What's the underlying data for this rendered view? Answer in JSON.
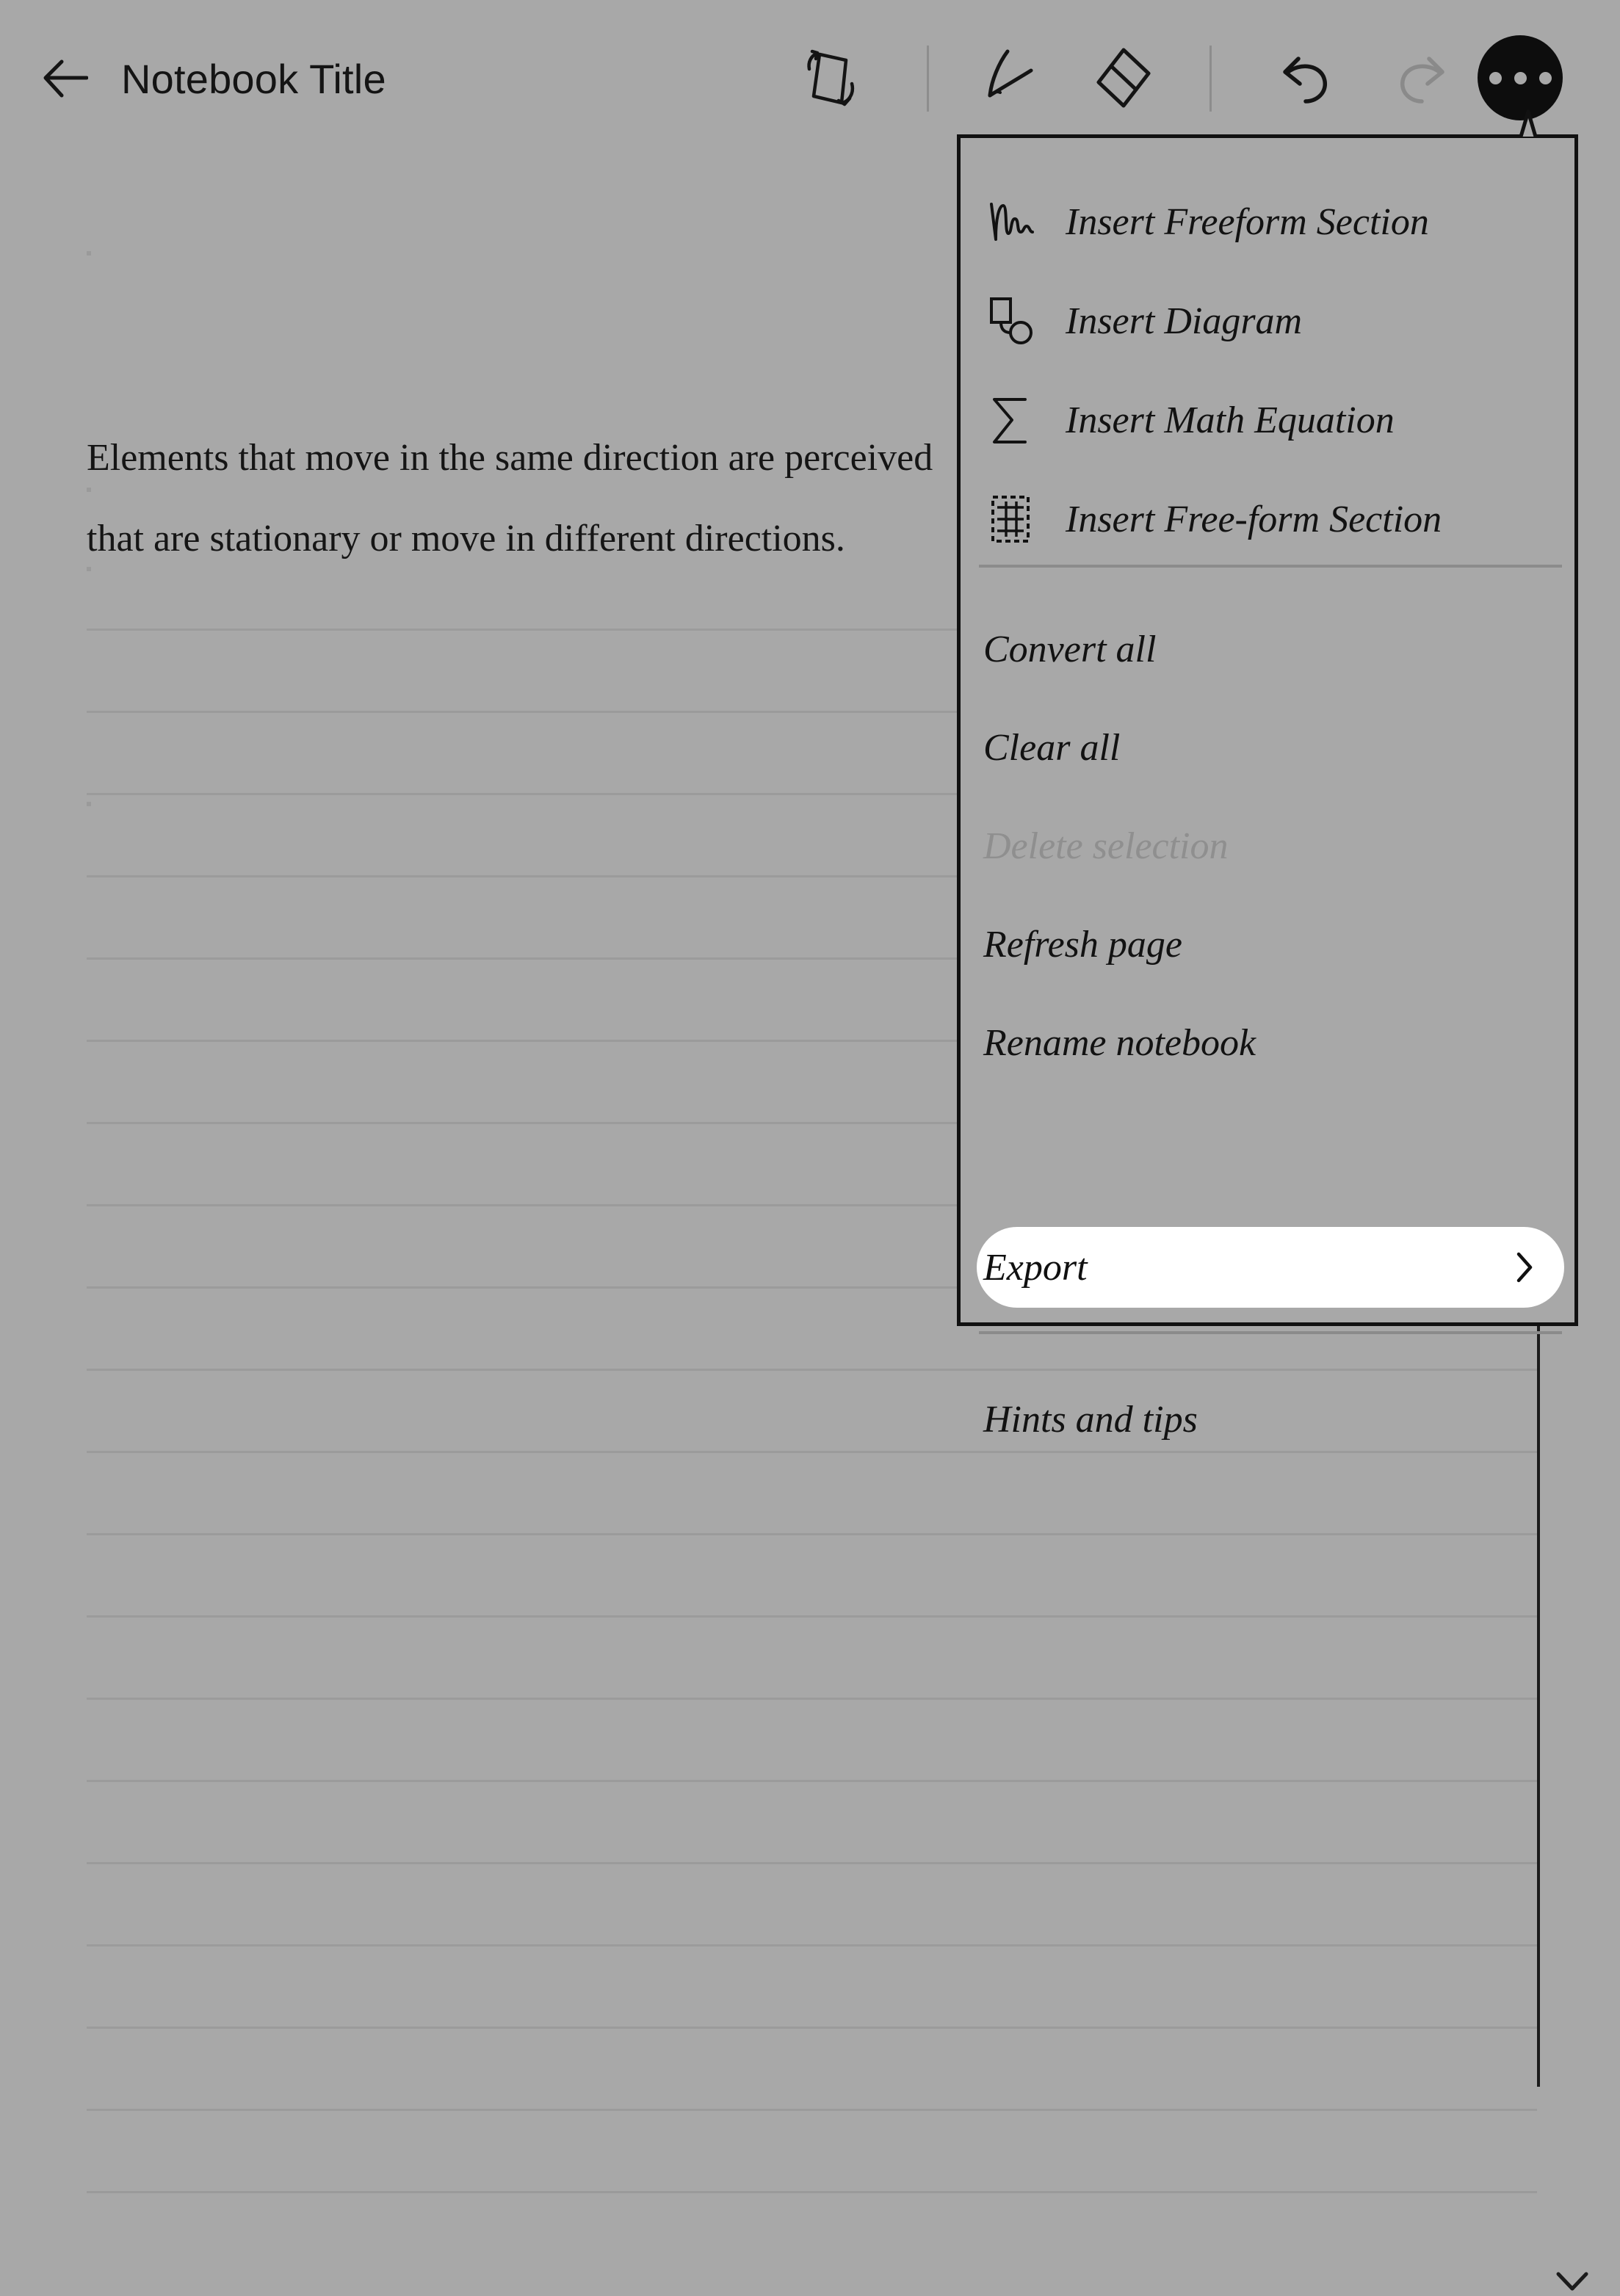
{
  "topbar": {
    "back_icon": "back-arrow-icon",
    "title": "Notebook Title",
    "tools": [
      {
        "id": "rotate",
        "icon": "rotate-page-icon",
        "name": "rotate-page-button",
        "enabled": true
      },
      {
        "id": "pen",
        "icon": "pen-nib-icon",
        "name": "pen-tool-button",
        "enabled": true
      },
      {
        "id": "eraser",
        "icon": "eraser-icon",
        "name": "eraser-tool-button",
        "enabled": true
      },
      {
        "id": "undo",
        "icon": "undo-arrow-icon",
        "name": "undo-button",
        "enabled": true
      },
      {
        "id": "redo",
        "icon": "redo-arrow-icon",
        "name": "redo-button",
        "enabled": false
      }
    ],
    "more_button": {
      "icon": "more-horizontal-icon",
      "dots": 3
    }
  },
  "page": {
    "body_text": {
      "line1": "Elements that move in the same direction are perceived",
      "line2": "that are stationary or move in different directions."
    },
    "ruled_line_count": 20,
    "scrollbar": {
      "icon": "chevron-down-icon"
    }
  },
  "menu": {
    "sections": [
      {
        "items": [
          {
            "label": "Insert Freeform Section",
            "icon": "handwriting-scribble-icon",
            "name": "menu-item-insert-freeform-section",
            "disabled": false
          },
          {
            "label": "Insert Diagram",
            "icon": "diagram-shapes-icon",
            "name": "menu-item-insert-diagram",
            "disabled": false
          },
          {
            "label": "Insert Math Equation",
            "icon": "sigma-sum-icon",
            "name": "menu-item-insert-math-equation",
            "disabled": false
          },
          {
            "label": "Insert Free-form Section",
            "icon": "table-grid-icon",
            "name": "menu-item-insert-free-form-section",
            "disabled": false
          }
        ]
      },
      {
        "items": [
          {
            "label": "Convert all",
            "icon": null,
            "name": "menu-item-convert-all",
            "disabled": false
          },
          {
            "label": "Clear all",
            "icon": null,
            "name": "menu-item-clear-all",
            "disabled": false
          },
          {
            "label": "Delete selection",
            "icon": null,
            "name": "menu-item-delete-selection",
            "disabled": true
          },
          {
            "label": "Refresh page",
            "icon": null,
            "name": "menu-item-refresh-page",
            "disabled": false
          },
          {
            "label": "Rename notebook",
            "icon": null,
            "name": "menu-item-rename-notebook",
            "disabled": false
          }
        ]
      },
      {
        "items": [
          {
            "label": "Hints and tips",
            "icon": null,
            "name": "menu-item-hints-and-tips",
            "disabled": false
          }
        ]
      }
    ],
    "highlighted_item": {
      "label": "Export",
      "name": "menu-item-export",
      "submenu_icon": "chevron-right-icon",
      "highlighted": true
    }
  },
  "colors": {
    "background": "#a8a8a8",
    "ink": "#121212",
    "disabled_text": "#8f8f8f",
    "rule_line": "#9b9b9b",
    "highlight_background": "#ffffff",
    "menu_border": "#111111"
  }
}
